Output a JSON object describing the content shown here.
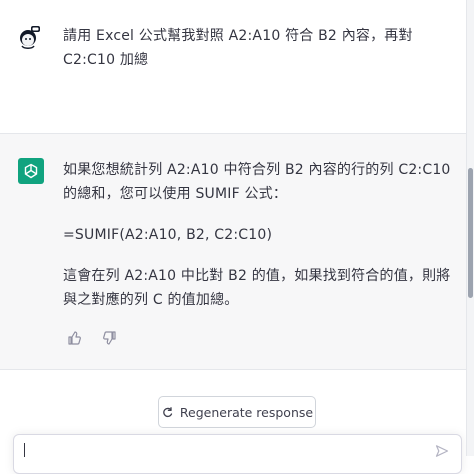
{
  "user_message": {
    "text": "請用 Excel 公式幫我對照 A2:A10 符合 B2 內容，再對 C2:C10 加總"
  },
  "assistant_message": {
    "paragraphs": [
      "如果您想統計列 A2:A10 中符合列 B2 內容的行的列 C2:C10 的總和，您可以使用 SUMIF 公式：",
      "=SUMIF(A2:A10, B2, C2:C10)",
      "這會在列 A2:A10 中比對 B2 的值，如果找到符合的值，則將與之對應的列 C 的值加總。"
    ],
    "feedback": {
      "like_icon": "thumbs-up-icon",
      "dislike_icon": "thumbs-down-icon"
    }
  },
  "controls": {
    "regenerate_label": "Regenerate response",
    "regenerate_icon": "refresh-icon",
    "composer_value": "",
    "send_icon": "send-icon"
  },
  "colors": {
    "assistant_bg": "#f7f7f8",
    "assistant_avatar": "#10a37f",
    "text": "#343541"
  }
}
